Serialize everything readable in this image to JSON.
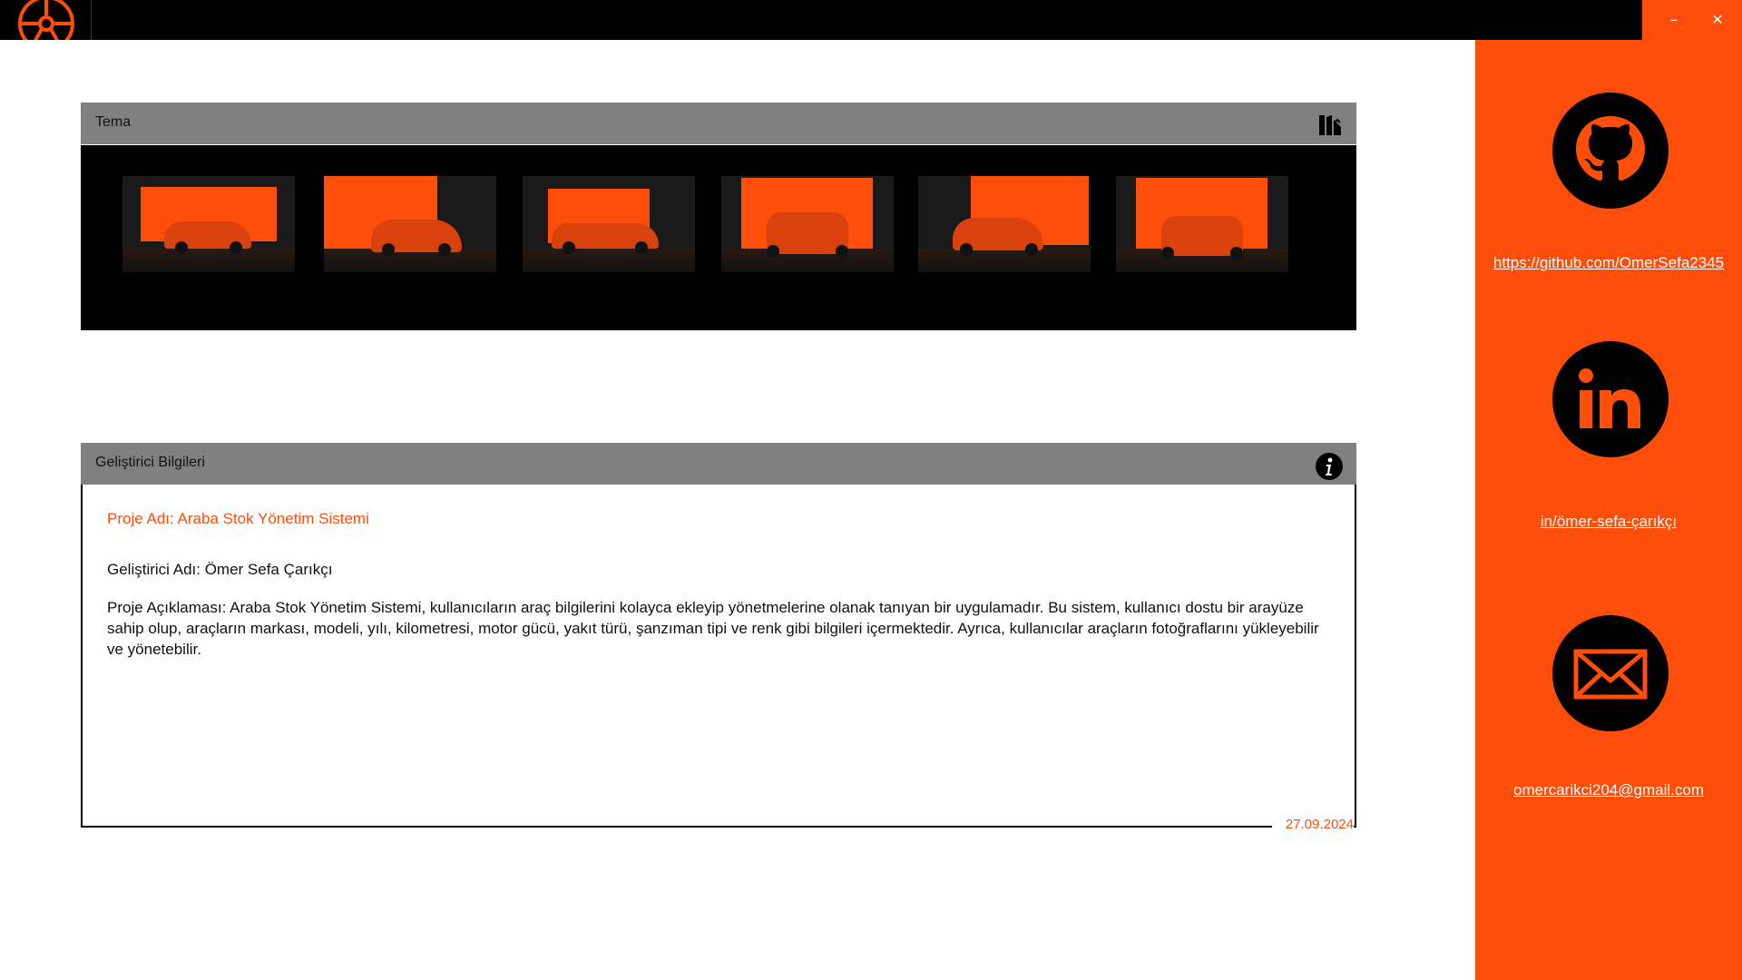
{
  "window": {
    "logo_icon": "wheel-icon",
    "minimize_glyph": "–",
    "close_glyph": "✕",
    "accent": "#ff4d0a"
  },
  "theme_card": {
    "title": "Tema",
    "icon": "palette-swatch-icon"
  },
  "developer_card": {
    "title": "Geliştirici Bilgileri",
    "icon": "info-icon",
    "project_name": "Proje Adı: Araba Stok Yönetim Sistemi",
    "developer_name": "Geliştirici Adı: Ömer Sefa Çarıkçı",
    "description": "Proje Açıklaması: Araba Stok Yönetim Sistemi, kullanıcıların araç bilgilerini kolayca ekleyip yönetmelerine olanak tanıyan bir uygulamadır. Bu sistem, kullanıcı dostu bir arayüze sahip olup, araçların markası, modeli, yılı, kilometresi, motor gücü, yakıt türü, şanzıman tipi ve renk gibi bilgileri içermektedir. Ayrıca, kullanıcılar araçların fotoğraflarını yükleyebilir ve yönetebilir.",
    "date": "27.09.2024"
  },
  "sidebar": {
    "github_link": "https://github.com/OmerSefa2345",
    "linkedin_link": "in/ömer-sefa-çarıkçı",
    "email_link": "omercarikci204@gmail.com"
  }
}
